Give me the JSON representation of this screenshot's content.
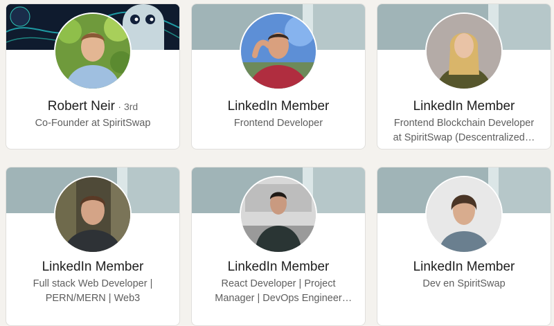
{
  "cards": [
    {
      "name": "Robert Neir",
      "degree": "· 3rd",
      "headline": "Co-Founder at SpiritSwap"
    },
    {
      "name": "LinkedIn Member",
      "headline": "Frontend Developer"
    },
    {
      "name": "LinkedIn Member",
      "headline": "Frontend Blockchain Developer at SpiritSwap (Descentralized…"
    },
    {
      "name": "LinkedIn Member",
      "headline": "Full stack Web Developer | PERN/MERN | Web3"
    },
    {
      "name": "LinkedIn Member",
      "headline": "React Developer | Project Manager | DevOps Engineer en…"
    },
    {
      "name": "LinkedIn Member",
      "headline": "Dev en SpiritSwap"
    }
  ],
  "colors": {
    "banner_default": "#a0b4b7",
    "card_bg": "#ffffff",
    "page_bg": "#f4f2ee"
  }
}
